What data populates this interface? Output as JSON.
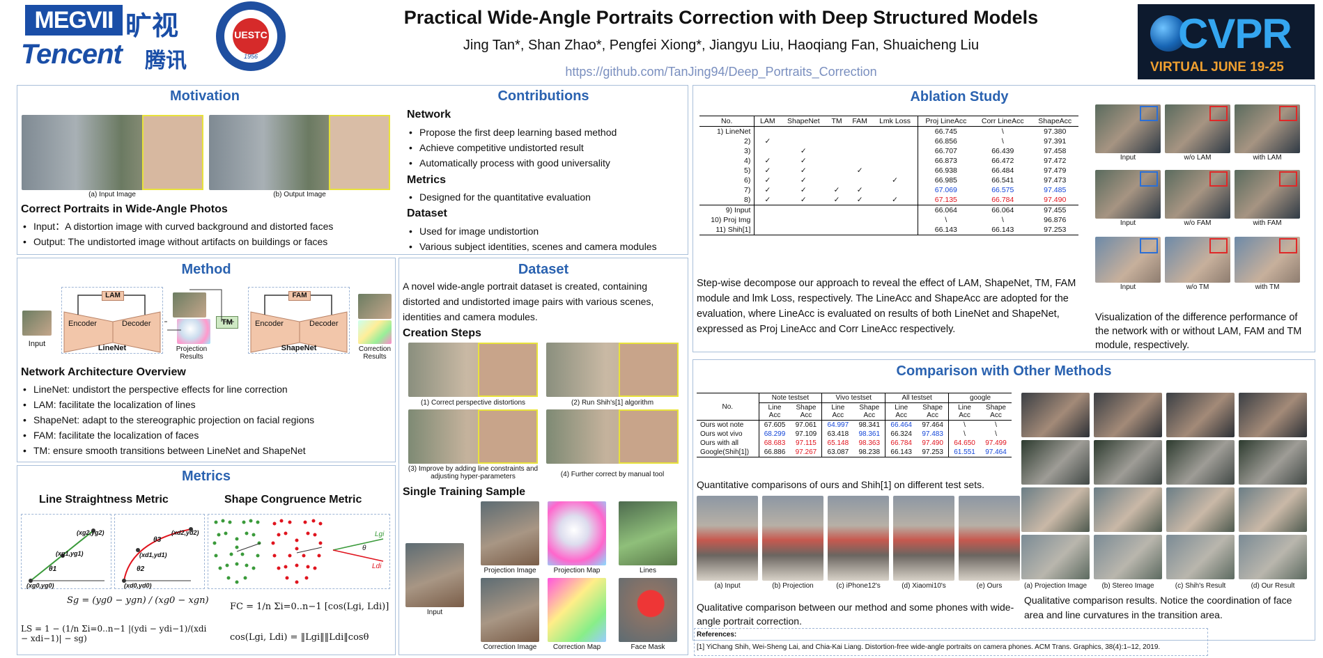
{
  "header": {
    "title": "Practical Wide-Angle Portraits Correction with Deep Structured Models",
    "authors": "Jing Tan*, Shan Zhao*, Pengfei Xiong*, Jiangyu Liu, Haoqiang Fan, Shuaicheng Liu",
    "url": "https://github.com/TanJing94/Deep_Portraits_Correction",
    "logo_megvii": "MEGVII",
    "logo_megvii_cn": "旷视",
    "logo_tencent": "Tencent",
    "logo_tencent_cn": "腾讯",
    "logo_uestc": "UESTC",
    "logo_uestc_year": "1956",
    "cvpr": "CVPR",
    "cvpr_sub": "VIRTUAL JUNE 19-25"
  },
  "motivation": {
    "title": "Motivation",
    "cap_a": "(a)  Input Image",
    "cap_b": "(b)  Output Image",
    "subtitle": "Correct Portraits in Wide-Angle Photos",
    "bullets": [
      "Input：A distortion image with curved background and distorted faces",
      "Output: The undistorted image without artifacts on buildings or faces"
    ]
  },
  "contributions": {
    "title": "Contributions",
    "network": "Network",
    "network_items": [
      "Propose the first deep learning based method",
      "Achieve competitive undistorted result",
      "Automatically process with good universality"
    ],
    "metrics": "Metrics",
    "metrics_items": [
      "Designed for the quantitative evaluation"
    ],
    "dataset": "Dataset",
    "dataset_items": [
      "Used for image undistortion",
      "Various subject identities, scenes and camera modules"
    ]
  },
  "method": {
    "title": "Method",
    "input": "Input",
    "lam": "LAM",
    "fam": "FAM",
    "encoder": "Encoder",
    "decoder": "Decoder",
    "linenet": "LineNet",
    "shapenet": "ShapeNet",
    "tm": "TM",
    "proj": "Projection\nResults",
    "corr": "Correction\nResults",
    "subtitle": "Network Architecture Overview",
    "bullets": [
      "LineNet: undistort the perspective effects for line correction",
      "LAM: facilitate the localization of lines",
      "ShapeNet: adapt to the stereographic projection on facial regions",
      "FAM: facilitate the localization of faces",
      "TM: ensure smooth transitions between LineNet and ShapeNet"
    ]
  },
  "metrics": {
    "title": "Metrics",
    "line_title": "Line Straightness Metric",
    "shape_title": "Shape Congruence Metric",
    "pts": [
      "(xg2,yg2)",
      "(xg1,yg1)",
      "(xg0,yg0)",
      "θ1",
      "(xd2,yd2)",
      "θ3",
      "(xd1,yd1)",
      "θ2",
      "(xd0,yd0)",
      "Lgi",
      "Ldi",
      "θ"
    ],
    "sg": "Sg = (yg0 − ygn) / (xg0 − xgn)",
    "ls": "LS = 1 − (1/n Σi=0..n−1 |(ydi − ydi−1)/(xdi − xdi−1)| − sg)",
    "fc": "FC = 1/n Σi=0..n−1 [cos(Lgi, Ldi)]",
    "cos": "cos(Lgi, Ldi) = ‖Lgi‖‖Ldi‖cosθ"
  },
  "dataset": {
    "title": "Dataset",
    "intro": "A novel wide-angle portrait dataset is created, containing distorted and undistorted image pairs with various scenes, identities and camera modules.",
    "creation": "Creation Steps",
    "steps": [
      "(1) Correct perspective distortions",
      "(2) Run Shih's[1] algorithm",
      "(3) Improve by adding line constraints and adjusting hyper-parameters",
      "(4) Further correct by manual tool"
    ],
    "single": "Single Training Sample",
    "labels": [
      "Input",
      "Projection Image",
      "Projection Map",
      "Lines",
      "Correction Image",
      "Correction Map",
      "Face Mask"
    ]
  },
  "ablation": {
    "title": "Ablation Study",
    "headers": [
      "No.",
      "LAM",
      "ShapeNet",
      "TM",
      "FAM",
      "Lmk Loss",
      "Proj LineAcc",
      "Corr LineAcc",
      "ShapeAcc"
    ],
    "rows": [
      [
        "1) LineNet",
        "",
        "",
        "",
        "",
        "",
        "66.745",
        "\\",
        "97.380"
      ],
      [
        "2)",
        "✓",
        "",
        "",
        "",
        "",
        "66.856",
        "\\",
        "97.391"
      ],
      [
        "3)",
        "",
        "✓",
        "",
        "",
        "",
        "66.707",
        "66.439",
        "97.458"
      ],
      [
        "4)",
        "✓",
        "✓",
        "",
        "",
        "",
        "66.873",
        "66.472",
        "97.472"
      ],
      [
        "5)",
        "✓",
        "✓",
        "",
        "✓",
        "",
        "66.938",
        "66.484",
        "97.479"
      ],
      [
        "6)",
        "✓",
        "✓",
        "",
        "",
        "✓",
        "66.985",
        "66.541",
        "97.473"
      ],
      [
        "7)",
        "✓",
        "✓",
        "✓",
        "✓",
        "",
        "67.069",
        "66.575",
        "97.485"
      ],
      [
        "8)",
        "✓",
        "✓",
        "✓",
        "✓",
        "✓",
        "67.135",
        "66.784",
        "97.490"
      ],
      [
        "9) Input",
        "",
        "",
        "",
        "",
        "",
        "66.064",
        "66.064",
        "97.455"
      ],
      [
        "10) Proj Img",
        "",
        "",
        "",
        "",
        "",
        "\\",
        "\\",
        "96.876"
      ],
      [
        "11) Shih[1]",
        "",
        "",
        "",
        "",
        "",
        "66.143",
        "66.143",
        "97.253"
      ]
    ],
    "text": "Step-wise decompose our approach to reveal the effect of LAM, ShapeNet, TM, FAM module and lmk Loss, respectively. The LineAcc and ShapeAcc are adopted for the evaluation, where LineAcc is evaluated on results of both LineNet and ShapeNet, expressed as Proj LineAcc and Corr LineAcc respectively.",
    "vis_labels": [
      "Input",
      "w/o LAM",
      "with LAM",
      "Input",
      "w/o FAM",
      "with FAM",
      "Input",
      "w/o TM",
      "with TM"
    ],
    "vis_text": "Visualization of the difference performance of the network with or without LAM, FAM and TM module, respectively."
  },
  "comparison": {
    "title": "Comparison with Other Methods",
    "groups": [
      "Note testset",
      "Vivo testset",
      "All testset",
      "google"
    ],
    "subheads": [
      "Line\nAcc",
      "Shape\nAcc"
    ],
    "no": "No.",
    "rows": [
      [
        "Ours wot note",
        "67.605",
        "97.061",
        "64.997",
        "98.341",
        "66.464",
        "97.464",
        "\\",
        "\\"
      ],
      [
        "Ours wot vivo",
        "68.299",
        "97.109",
        "63.418",
        "98.361",
        "66.324",
        "97.483",
        "\\",
        "\\"
      ],
      [
        "Ours with all",
        "68.683",
        "97.115",
        "65.148",
        "98.363",
        "66.784",
        "97.490",
        "64.650",
        "97.499"
      ],
      [
        "Google(Shih[1])",
        "66.886",
        "97.267",
        "63.087",
        "98.238",
        "66.143",
        "97.253",
        "61.551",
        "97.464"
      ]
    ],
    "table_caption": "Quantitative comparisons of ours and Shih[1] on different test sets.",
    "phone_labels": [
      "(a) Input",
      "(b) Projection",
      "(c) iPhone12's",
      "(d) Xiaomi10's",
      "(e) Ours"
    ],
    "phone_caption": "Qualitative comparison between our method and some phones with wide-angle portrait correction.",
    "grid_labels": [
      "(a) Projection Image",
      "(b) Stereo Image",
      "(c) Shih's Result",
      "(d) Our Result"
    ],
    "grid_caption": "Qualitative comparison results. Notice the coordination of face area and line curvatures in the transition area."
  },
  "references": {
    "title": "References:",
    "items": [
      "[1] YiChang Shih, Wei-Sheng Lai, and Chia-Kai Liang. Distortion-free wide-angle portraits on camera phones. ACM Trans. Graphics, 38(4):1–12, 2019."
    ]
  }
}
